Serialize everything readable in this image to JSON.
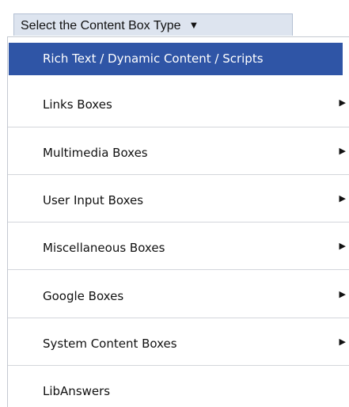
{
  "dropdown": {
    "label": "Select the Content Box Type",
    "caret": "▼"
  },
  "menu": {
    "items": [
      {
        "label": "Rich Text / Dynamic Content / Scripts",
        "selected": true,
        "has_submenu": false
      },
      {
        "label": "Links Boxes",
        "selected": false,
        "has_submenu": true
      },
      {
        "label": "Multimedia Boxes",
        "selected": false,
        "has_submenu": true
      },
      {
        "label": "User Input Boxes",
        "selected": false,
        "has_submenu": true
      },
      {
        "label": "Miscellaneous Boxes",
        "selected": false,
        "has_submenu": true
      },
      {
        "label": "Google Boxes",
        "selected": false,
        "has_submenu": true
      },
      {
        "label": "System Content Boxes",
        "selected": false,
        "has_submenu": true
      },
      {
        "label": "LibAnswers",
        "selected": false,
        "has_submenu": false
      }
    ],
    "submenu_arrow": "▶"
  },
  "colors": {
    "selected_background": "#2f55a6",
    "trigger_background": "#dde4ef",
    "accent": "#39a8f0"
  }
}
